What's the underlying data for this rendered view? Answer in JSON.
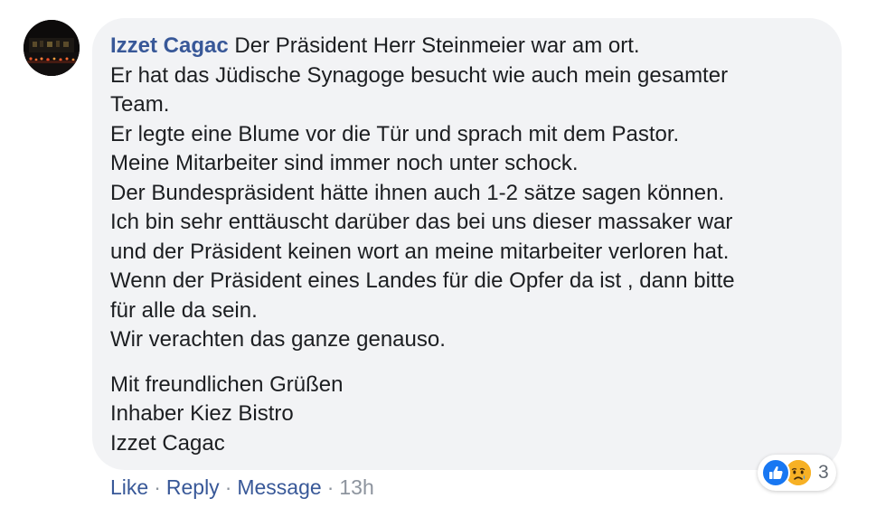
{
  "comment": {
    "author": "Izzet Cagac",
    "avatar_icon": "profile-photo-night-scene",
    "paragraph_lines": [
      "Der Präsident Herr Steinmeier war am ort.",
      "Er hat das Jüdische Synagoge besucht wie auch mein gesamter",
      "Team.",
      "Er legte eine Blume vor die Tür und sprach mit dem Pastor.",
      "Meine Mitarbeiter sind immer noch unter schock.",
      "Der Bundespräsident hätte ihnen auch 1-2 sätze sagen können.",
      "Ich bin sehr enttäuscht darüber das bei uns dieser massaker war",
      "und der Präsident keinen wort an meine mitarbeiter verloren hat.",
      "Wenn der Präsident eines Landes für die Opfer da ist , dann bitte",
      "für alle da sein.",
      "Wir verachten das ganze genauso."
    ],
    "closing_lines": [
      "Mit freundlichen Grüßen",
      "Inhaber Kiez Bistro",
      "Izzet Cagac"
    ]
  },
  "actions": {
    "like": "Like",
    "reply": "Reply",
    "message": "Message",
    "separator": "·",
    "time": "13h"
  },
  "reactions": {
    "icons": [
      "like-icon",
      "sad-icon"
    ],
    "count": "3"
  },
  "colors": {
    "author_link": "#385898",
    "bubble_background": "#f2f3f5",
    "meta_text": "#8d949e",
    "like_blue": "#1877f2",
    "sad_yellow": "#f7b125"
  }
}
